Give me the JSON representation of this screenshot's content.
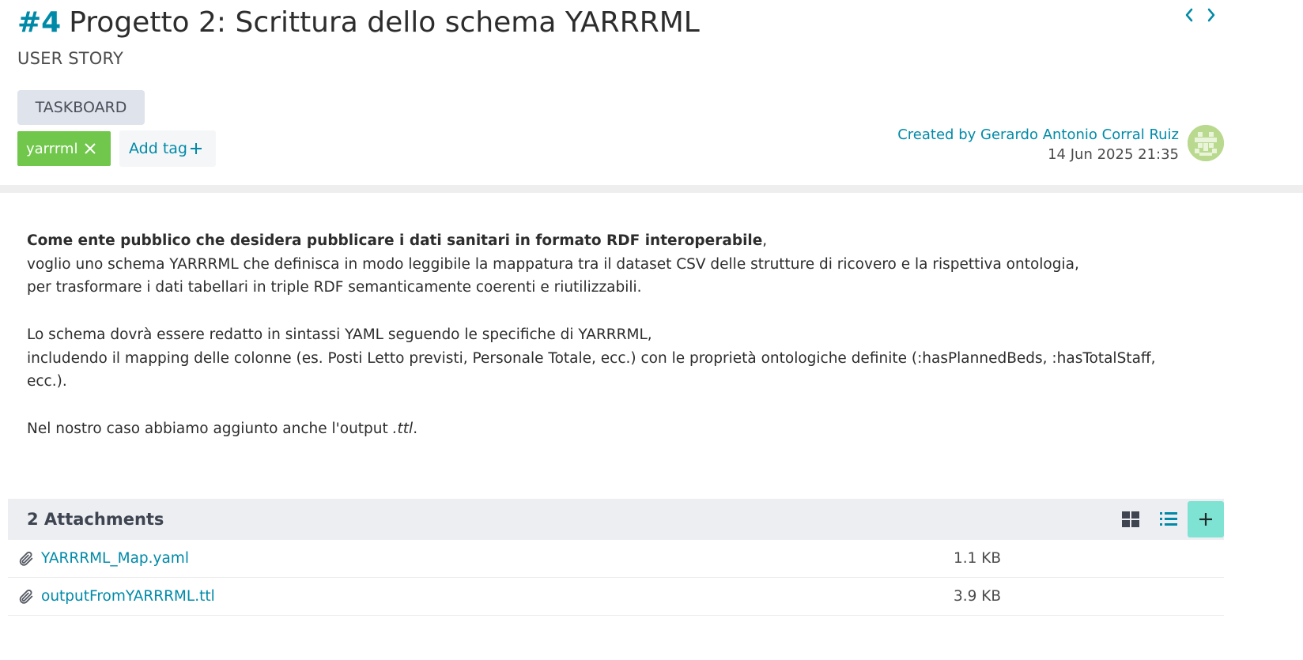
{
  "story": {
    "ref": "#4",
    "title": "Progetto 2: Scrittura dello schema YARRRML",
    "type": "USER STORY"
  },
  "taskboard_label": "TASKBOARD",
  "tags": [
    {
      "label": "yarrrml",
      "color": "#70c74b"
    }
  ],
  "add_tag_label": "Add tag",
  "created": {
    "by": "Created by Gerardo Antonio Corral Ruiz",
    "date": "14 Jun 2025 21:35"
  },
  "description": {
    "bold_intro": "Come ente pubblico che desidera pubblicare i dati sanitari in formato RDF interoperabile",
    "intro_tail": ",",
    "line2": "voglio uno schema YARRRML che definisca in modo leggibile la mappatura tra il dataset CSV delle strutture di ricovero e la rispettiva ontologia,",
    "line3": "per trasformare i dati tabellari in triple RDF semanticamente coerenti e riutilizzabili.",
    "line4": "Lo schema dovrà essere redatto in sintassi YAML seguendo le specifiche di YARRRML,",
    "line5": "includendo il mapping delle colonne (es. Posti Letto previsti, Personale Totale, ecc.) con le proprietà ontologiche definite (:hasPlannedBeds, :hasTotalStaff, ecc.).",
    "line6_prefix": "Nel nostro caso abbiamo aggiunto anche l'output ",
    "line6_em": ".ttl",
    "line6_suffix": "."
  },
  "attachments": {
    "title": "2 Attachments",
    "items": [
      {
        "name": "YARRRML_Map.yaml",
        "size": "1.1 KB"
      },
      {
        "name": "outputFromYARRRML.ttl",
        "size": "3.9 KB"
      }
    ]
  },
  "colors": {
    "accent": "#008aa8",
    "tag_green": "#70c74b",
    "add_button": "#7fe3d3"
  }
}
